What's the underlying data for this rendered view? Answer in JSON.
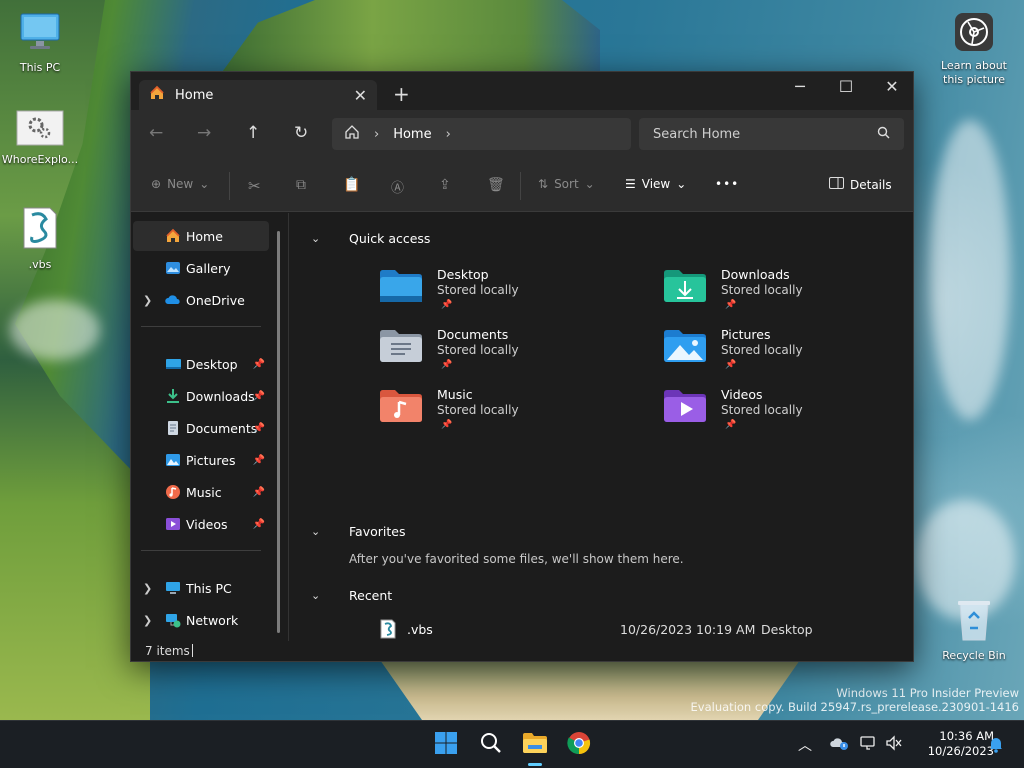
{
  "desktop": {
    "icons": [
      {
        "label": "This PC",
        "icon": "monitor-icon"
      },
      {
        "label": "WhoreExplo...",
        "icon": "gear-file-icon"
      },
      {
        "label": ".vbs",
        "icon": "vbs-script-icon"
      },
      {
        "label": "Learn about this picture",
        "icon": "camera-icon"
      },
      {
        "label": "Recycle Bin",
        "icon": "recycle-bin-icon"
      }
    ],
    "watermark_line1": "Windows 11 Pro Insider Preview",
    "watermark_line2": "Evaluation copy. Build 25947.rs_prerelease.230901-1416"
  },
  "explorer": {
    "tab_title": "Home",
    "window_controls": {
      "minimize": "─",
      "maximize": "☐",
      "close": "✕"
    },
    "address": {
      "crumb": "Home"
    },
    "search": {
      "placeholder": "Search Home"
    },
    "toolbar": {
      "new": "New",
      "sort": "Sort",
      "view": "View",
      "more": "•••",
      "details": "Details"
    },
    "sidebar": {
      "top": [
        {
          "label": "Home",
          "icon": "home-icon",
          "selected": true
        },
        {
          "label": "Gallery",
          "icon": "gallery-icon"
        },
        {
          "label": "OneDrive",
          "icon": "onedrive-icon",
          "expandable": true
        }
      ],
      "pinned": [
        {
          "label": "Desktop",
          "icon": "desktop-folder-icon"
        },
        {
          "label": "Downloads",
          "icon": "download-icon"
        },
        {
          "label": "Documents",
          "icon": "documents-icon"
        },
        {
          "label": "Pictures",
          "icon": "pictures-icon"
        },
        {
          "label": "Music",
          "icon": "music-icon"
        },
        {
          "label": "Videos",
          "icon": "videos-icon"
        }
      ],
      "bottom": [
        {
          "label": "This PC",
          "icon": "monitor-icon"
        },
        {
          "label": "Network",
          "icon": "network-icon"
        }
      ]
    },
    "sections": {
      "quick_access": "Quick access",
      "favorites": "Favorites",
      "recent": "Recent"
    },
    "quick_access": [
      {
        "name": "Desktop",
        "sub": "Stored locally",
        "icon": "desktop-folder-icon"
      },
      {
        "name": "Downloads",
        "sub": "Stored locally",
        "icon": "downloads-folder-icon"
      },
      {
        "name": "Documents",
        "sub": "Stored locally",
        "icon": "documents-folder-icon"
      },
      {
        "name": "Pictures",
        "sub": "Stored locally",
        "icon": "pictures-folder-icon"
      },
      {
        "name": "Music",
        "sub": "Stored locally",
        "icon": "music-folder-icon"
      },
      {
        "name": "Videos",
        "sub": "Stored locally",
        "icon": "videos-folder-icon"
      }
    ],
    "favorites_message": "After you've favorited some files, we'll show them here.",
    "recent": [
      {
        "name": ".vbs",
        "date": "10/26/2023 10:19 AM",
        "location": "Desktop"
      }
    ],
    "status": "7 items"
  },
  "taskbar": {
    "clock_time": "10:36 AM",
    "clock_date": "10/26/2023"
  },
  "colors": {
    "accent": "#60cdff",
    "window_bg": "#1c1c1c",
    "chrome_bg": "#2c2c2c"
  }
}
